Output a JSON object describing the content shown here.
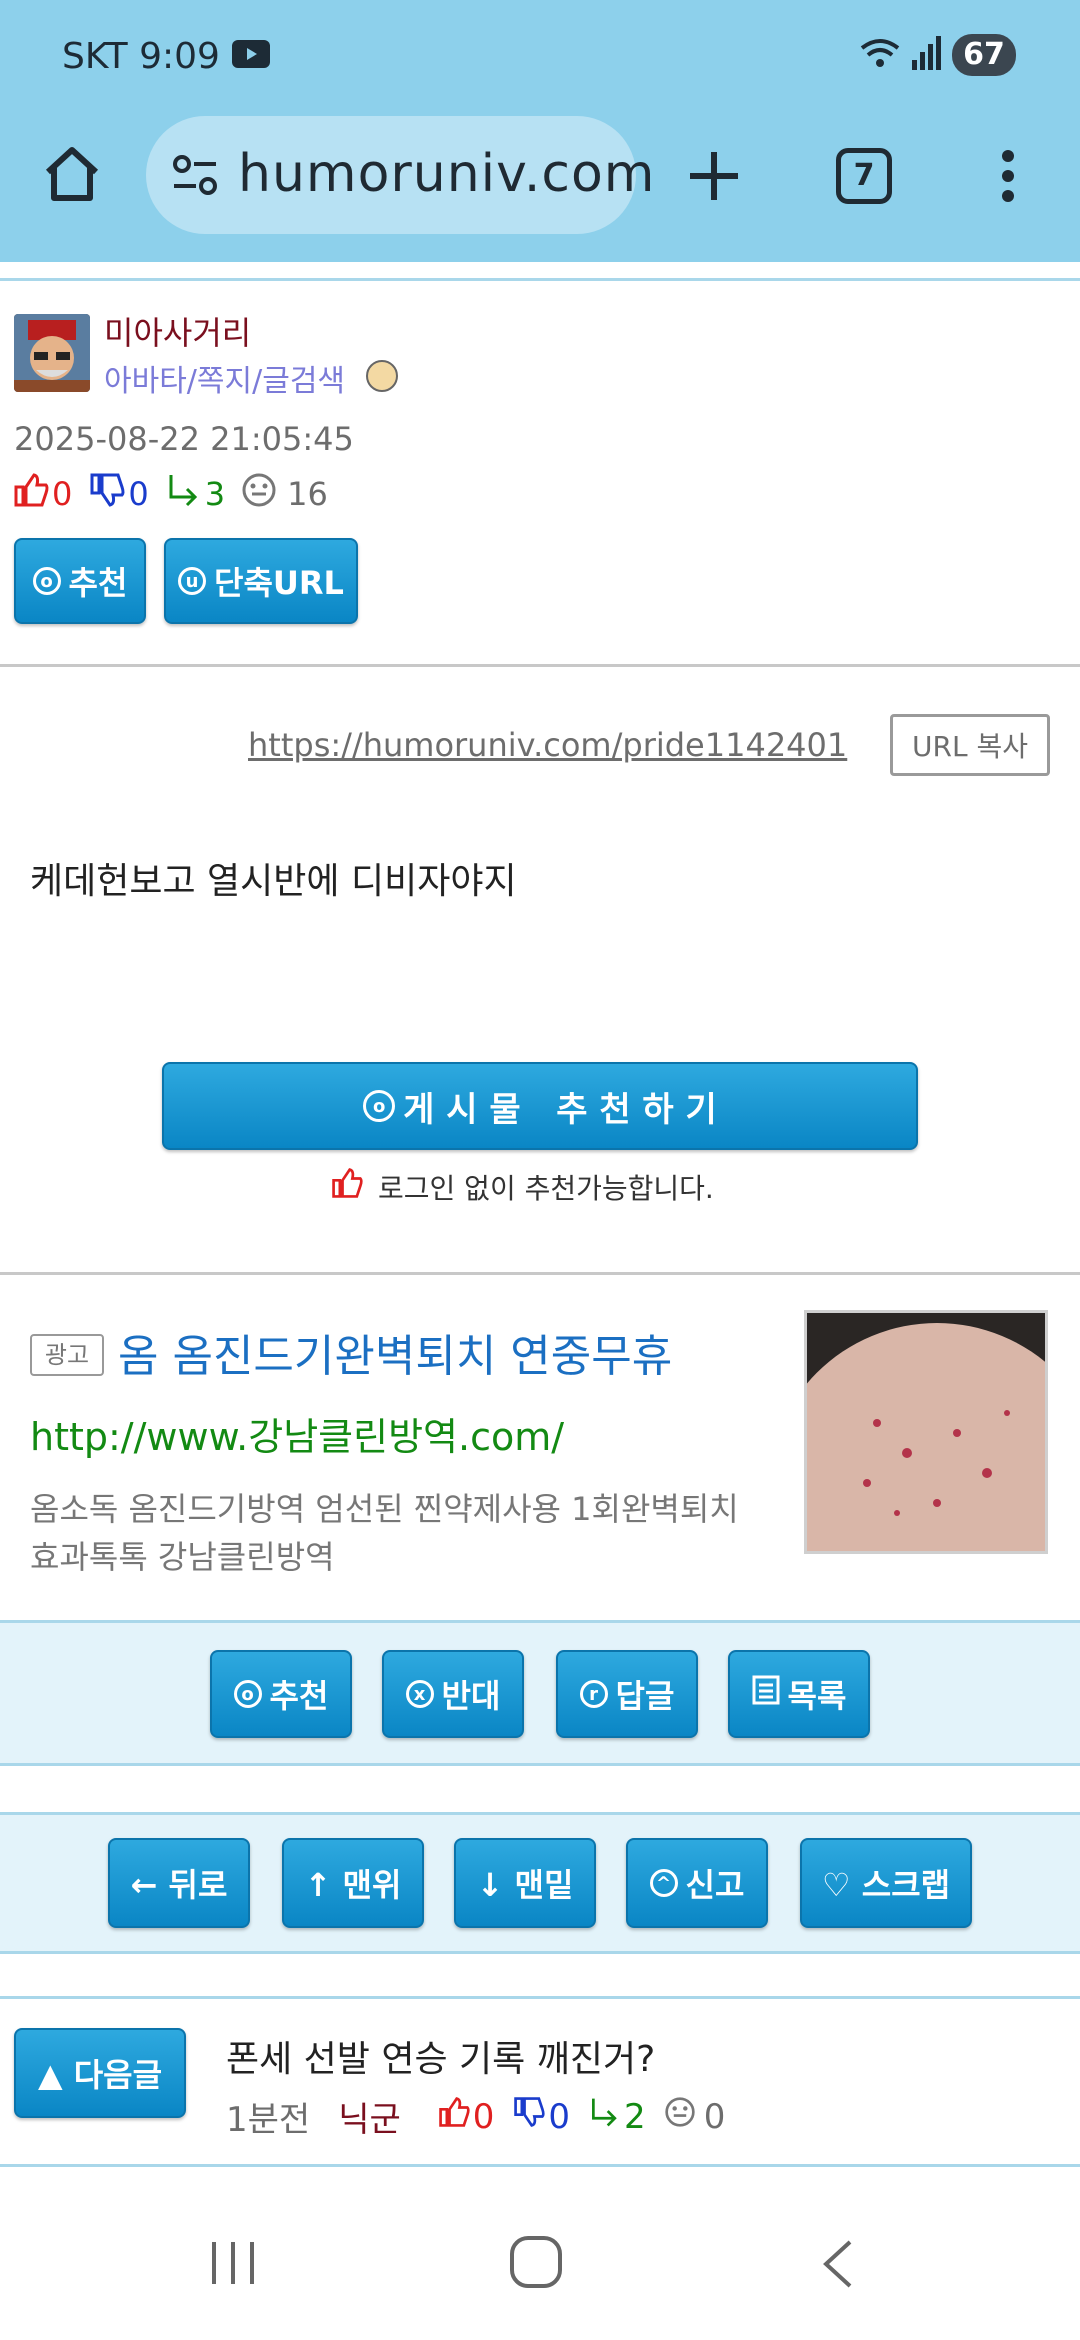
{
  "status_bar": {
    "carrier_time": "SKT 9:09",
    "battery": "67"
  },
  "browser": {
    "url": "humoruniv.com",
    "tab_count": "7"
  },
  "author": {
    "name": "미아사거리",
    "links": "아바타/쪽지/글검색"
  },
  "post_meta": {
    "datetime": "2025-08-22 21:05:45",
    "up": "0",
    "down": "0",
    "reply": "3",
    "views": "16"
  },
  "top_buttons": {
    "recommend": "추천",
    "short_url": "단축URL"
  },
  "post": {
    "url": "https://humoruniv.com/pride1142401",
    "copy_label": "URL 복사",
    "body": "케데헌보고 열시반에 디비자야지",
    "recommend_big": "게 시 물   추 천 하 기",
    "no_login_note": "로그인 없이 추천가능합니다."
  },
  "ad": {
    "badge": "광고",
    "title": "옴 옴진드기완벽퇴치 연중무휴",
    "link": "http://www.강남클린방역.com/",
    "desc_line1": "옴소독 옴진드기방역 엄선된 찐약제사용 1회완벽퇴치",
    "desc_line2": "효과톡톡 강남클린방역"
  },
  "action_buttons": {
    "recommend": "추천",
    "oppose": "반대",
    "reply": "답글",
    "list": "목록"
  },
  "nav_buttons": {
    "back": "← 뒤로",
    "top": "↑ 맨위",
    "bottom": "↓ 맨밑",
    "report": "신고",
    "scrap": "♡ 스크랩"
  },
  "next_post": {
    "label": "▲ 다음글",
    "title": "폰세 선발 연승 기록 깨진거?",
    "time": "1분전",
    "author": "닉군",
    "up": "0",
    "down": "0",
    "reply": "2",
    "views": "0"
  },
  "colors": {
    "chrome": "#8dd0eb",
    "button": "#1a97d4",
    "up": "#e02020",
    "down": "#1a3ccc",
    "reply": "#138a13"
  }
}
